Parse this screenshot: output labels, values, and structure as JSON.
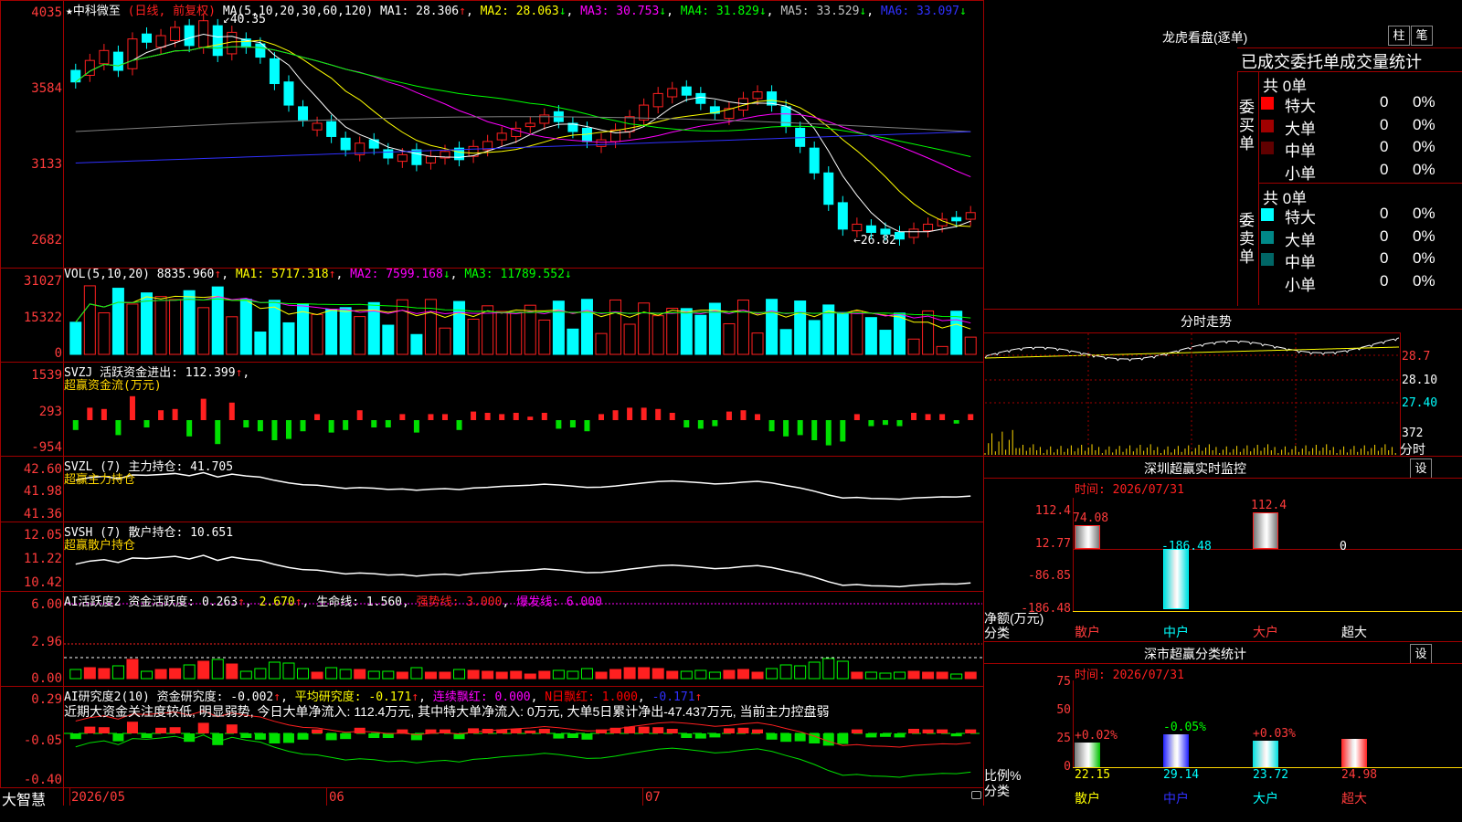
{
  "colors": {
    "up": "#ff2020",
    "down": "#00ffff",
    "ma1": "#ffffff",
    "ma2": "#ffff00",
    "ma3": "#ff00ff",
    "ma4": "#00ff00",
    "ma5": "#808080",
    "ma6": "#3030ff",
    "border": "#a00000",
    "axis": "#ff3b3b",
    "gold": "#ffd700"
  },
  "main": {
    "star": "★",
    "stock_name": "中科微至",
    "period": "(日线, 前复权)",
    "ma_label": "MA(5,10,20,30,60,120)",
    "ma1": "MA1: 28.306",
    "ma2": "MA2: 28.063",
    "ma3": "MA3: 30.753",
    "ma4": "MA4: 31.829",
    "ma5": "MA5: 33.529",
    "ma6": "MA6: 33.097",
    "high_marker": "40.35",
    "low_marker": "←26.82",
    "y_ticks": [
      "4035",
      "3584",
      "3133",
      "2682"
    ]
  },
  "vol": {
    "label": "VOL(5,10,20)",
    "value": "8835.960",
    "ma1": "MA1: 5717.318",
    "ma2": "MA2: 7599.168",
    "ma3": "MA3: 11789.552",
    "y_ticks": [
      "31027",
      "15322",
      "0"
    ]
  },
  "svzj": {
    "label": "SVZJ  活跃资金进出: 112.399",
    "sub": "超赢资金流(万元)",
    "y_ticks": [
      "1539",
      "293",
      "-954"
    ]
  },
  "svzl": {
    "label": "SVZL (7) 主力持仓: 41.705",
    "sub": "超赢主力持仓",
    "y_ticks": [
      "42.60",
      "41.98",
      "41.36"
    ]
  },
  "svsh": {
    "label": "SVSH (7) 散户持仓: 10.651",
    "sub": "超赢散户持仓",
    "y_ticks": [
      "12.05",
      "11.22",
      "10.42"
    ]
  },
  "ai_active": {
    "label": "AI活跃度2 资金活跃度: 0.263",
    "v2": "2.670",
    "life": "生命线: 1.560",
    "strong": "强势线: 3.000",
    "burst": "爆发线: 6.000",
    "y_ticks": [
      "6.00",
      "2.96",
      "0.00"
    ]
  },
  "ai_research": {
    "label": "AI研究度2(10) 资金研究度: -0.002",
    "avg": "平均研究度: -0.171",
    "cont": "连续飘红: 0.000",
    "nday": "N日飘红: 1.000",
    "last": "-0.171",
    "comment": "近期大资金关注度较低, 明显弱势, 今日大单净流入: 112.4万元, 其中特大单净流入: 0万元, 大单5日累计净出-47.437万元, 当前主力控盘弱",
    "y_ticks": [
      "0.29",
      "-0.05",
      "-0.40"
    ]
  },
  "bottom": {
    "brand": "大智慧",
    "dates": [
      "2026/05",
      "06",
      "07"
    ]
  },
  "longhu": {
    "title": "龙虎看盘(逐单)",
    "btn_zhu": "柱",
    "btn_bi": "笔",
    "header": "已成交委托单成交量统计",
    "buy": {
      "side": "委买单",
      "count": "共 0单",
      "rows": [
        {
          "name": "特大",
          "val": "0",
          "pct": "0%",
          "color": "#ff0000"
        },
        {
          "name": "大单",
          "val": "0",
          "pct": "0%",
          "color": "#a00000"
        },
        {
          "name": "中单",
          "val": "0",
          "pct": "0%",
          "color": "#600000"
        },
        {
          "name": "小单",
          "val": "0",
          "pct": "0%",
          "color": ""
        }
      ]
    },
    "sell": {
      "side": "委卖单",
      "count": "共 0单",
      "rows": [
        {
          "name": "特大",
          "val": "0",
          "pct": "0%",
          "color": "#00ffff"
        },
        {
          "name": "大单",
          "val": "0",
          "pct": "0%",
          "color": "#008888"
        },
        {
          "name": "中单",
          "val": "0",
          "pct": "0%",
          "color": "#006666"
        },
        {
          "name": "小单",
          "val": "0",
          "pct": "0%",
          "color": ""
        }
      ]
    }
  },
  "fenshi": {
    "title": "分时走势",
    "y_ticks": [
      "28.7",
      "28.10",
      "27.40"
    ],
    "vol_tick": "372",
    "unit": "分时"
  },
  "monitor": {
    "title": "深圳超赢实时监控",
    "btn": "设",
    "time": "时间: 2026/07/31",
    "y_ticks": [
      "112.4",
      "12.77",
      "-86.85",
      "-186.48"
    ],
    "ylabel": "净额(万元)",
    "xlabel": "分类",
    "cats": [
      "散户",
      "中户",
      "大户",
      "超大"
    ],
    "values": [
      "74.08",
      "-186.48",
      "112.4",
      "0"
    ]
  },
  "classify": {
    "title": "深市超赢分类统计",
    "btn": "设",
    "time": "时间: 2026/07/31",
    "y_ticks": [
      "75",
      "50",
      "25",
      "0"
    ],
    "ylabel": "比例%",
    "xlabel": "分类",
    "cats": [
      "散户",
      "中户",
      "大户",
      "超大"
    ],
    "top_vals": [
      "+0.02%",
      "-0.05%",
      "+0.03%",
      ""
    ],
    "bottom_vals": [
      "22.15",
      "29.14",
      "23.72",
      "24.98"
    ]
  }
}
